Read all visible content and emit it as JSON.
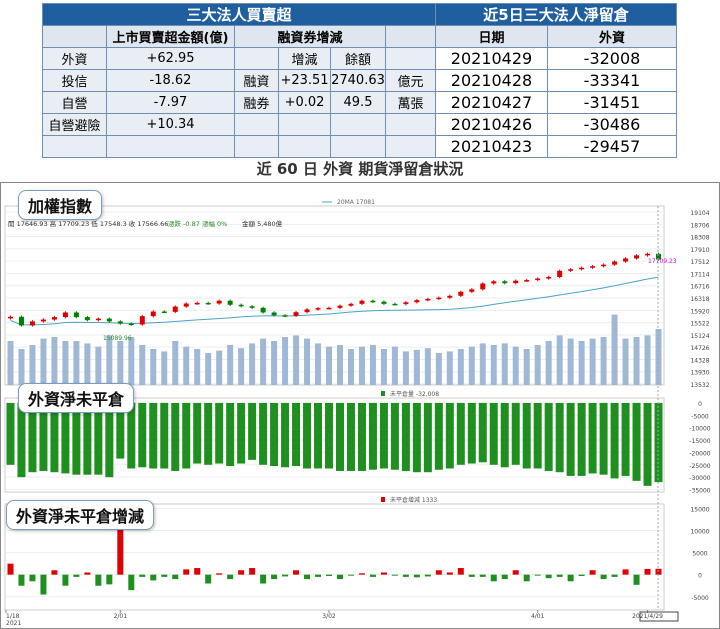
{
  "table1": {
    "title": "三大法人買賣超",
    "col_netbuy": "上市買賣超金額(億)",
    "col_margin": "融資券增減",
    "col_change": "增減",
    "col_balance": "餘額",
    "rows": [
      {
        "label": "外資",
        "value": "+62.95",
        "m_label": "",
        "change": "",
        "balance": "",
        "unit": ""
      },
      {
        "label": "投信",
        "value": "-18.62",
        "m_label": "融資",
        "change": "+23.51",
        "balance": "2740.63",
        "unit": "億元"
      },
      {
        "label": "自營",
        "value": "-7.97",
        "m_label": "融券",
        "change": "+0.02",
        "balance": "49.5",
        "unit": "萬張"
      },
      {
        "label": "自營避險",
        "value": "+10.34",
        "m_label": "",
        "change": "",
        "balance": "",
        "unit": ""
      },
      {
        "label": "",
        "value": "",
        "m_label": "",
        "change": "",
        "balance": "",
        "unit": ""
      }
    ]
  },
  "table2": {
    "title": "近5日三大法人淨留倉",
    "col_date": "日期",
    "col_foreign": "外資",
    "rows": [
      {
        "date": "20210429",
        "value": "-32008"
      },
      {
        "date": "20210428",
        "value": "-33341"
      },
      {
        "date": "20210427",
        "value": "-31451"
      },
      {
        "date": "20210426",
        "value": "-30486"
      },
      {
        "date": "20210423",
        "value": "-29457"
      }
    ]
  },
  "caption": "近 60 日 外資 期貨淨留倉狀況",
  "chart_data": [
    {
      "type": "candlestick",
      "label": "加權指數",
      "ma_legend": "20MA 17081",
      "info": "開 17646.93  高 17709.23  低 17548.3  收 17566.66",
      "change_info": "漲跌 -0.87  漲幅  0%",
      "amount_info": "金額 5,480億",
      "close_label": "17709.23",
      "low_label": "15089.96",
      "yticks": [
        "19104",
        "18706",
        "18308",
        "17910",
        "17512",
        "17114",
        "16716",
        "16318",
        "15920",
        "15522",
        "15124",
        "14726",
        "14328",
        "13930",
        "13532"
      ],
      "ylim": [
        13500,
        19300
      ],
      "closes": [
        15710,
        15430,
        15560,
        15620,
        15700,
        15850,
        15700,
        15600,
        15650,
        15560,
        15490,
        15460,
        15730,
        15880,
        15870,
        16040,
        16140,
        16160,
        16140,
        16230,
        16100,
        16050,
        16000,
        15850,
        15760,
        15740,
        15860,
        15950,
        15990,
        16000,
        16070,
        16130,
        16230,
        16200,
        16130,
        16120,
        16180,
        16250,
        16290,
        16330,
        16390,
        16520,
        16600,
        16790,
        16860,
        16800,
        16880,
        16900,
        16950,
        17000,
        17200,
        17250,
        17300,
        17350,
        17400,
        17500,
        17600,
        17700,
        17750,
        17566
      ],
      "volume": [
        0.55,
        0.45,
        0.5,
        0.58,
        0.6,
        0.55,
        0.55,
        0.52,
        0.48,
        0.62,
        0.55,
        0.6,
        0.5,
        0.45,
        0.42,
        0.55,
        0.48,
        0.45,
        0.4,
        0.43,
        0.5,
        0.46,
        0.52,
        0.58,
        0.55,
        0.6,
        0.62,
        0.58,
        0.52,
        0.48,
        0.5,
        0.45,
        0.48,
        0.5,
        0.45,
        0.48,
        0.42,
        0.44,
        0.46,
        0.4,
        0.42,
        0.45,
        0.48,
        0.52,
        0.5,
        0.52,
        0.48,
        0.45,
        0.5,
        0.55,
        0.62,
        0.58,
        0.55,
        0.58,
        0.6,
        0.88,
        0.58,
        0.6,
        0.62,
        0.7
      ]
    },
    {
      "type": "bar",
      "label": "外資淨未平倉",
      "legend": "未平倉量 -32,008",
      "yticks": [
        "0",
        "-5000",
        "-10000",
        "-15000",
        "-20000",
        "-25000",
        "-30000",
        "-35000"
      ],
      "ylim": [
        -36000,
        2000
      ],
      "values": [
        -25000,
        -30000,
        -28000,
        -27500,
        -28000,
        -28500,
        -29000,
        -29000,
        -29000,
        -30000,
        -22500,
        -26500,
        -26000,
        -26500,
        -26500,
        -27500,
        -26500,
        -24500,
        -25000,
        -24500,
        -25500,
        -24500,
        -23000,
        -25000,
        -25500,
        -26000,
        -25500,
        -26500,
        -26500,
        -26500,
        -27500,
        -27500,
        -27500,
        -27000,
        -26500,
        -27000,
        -27500,
        -28000,
        -28000,
        -27000,
        -26500,
        -25000,
        -24500,
        -24000,
        -25000,
        -26000,
        -25000,
        -26500,
        -26500,
        -27500,
        -28000,
        -29500,
        -29500,
        -28500,
        -29000,
        -30500,
        -29500,
        -31500,
        -33500,
        -32008
      ]
    },
    {
      "type": "bar",
      "label": "外資淨未平倉增減",
      "legend": "未平倉增減 1333",
      "yticks": [
        "15000",
        "10000",
        "5000",
        "0",
        "-5000"
      ],
      "ylim": [
        -8000,
        16000
      ],
      "values": [
        2500,
        -2500,
        -1500,
        -4500,
        1000,
        -2500,
        -500,
        500,
        -2500,
        -2200,
        10500,
        -3500,
        -500,
        -1300,
        -500,
        -1000,
        1200,
        1500,
        -2000,
        300,
        -1000,
        1000,
        1500,
        -2000,
        -1000,
        -400,
        1000,
        -1000,
        -500,
        -300,
        -1000,
        -200,
        300,
        -500,
        500,
        -200,
        -500,
        -600,
        -400,
        1000,
        500,
        1500,
        -500,
        -500,
        -1500,
        -1000,
        1000,
        -1500,
        -100,
        -800,
        -500,
        -1500,
        -300,
        1000,
        -1000,
        -500,
        1200,
        -2300,
        1300,
        1333
      ]
    }
  ],
  "x_ticks": [
    "1/18\n2021",
    "2/01",
    "3/02",
    "4/01",
    "2021/4/29"
  ]
}
